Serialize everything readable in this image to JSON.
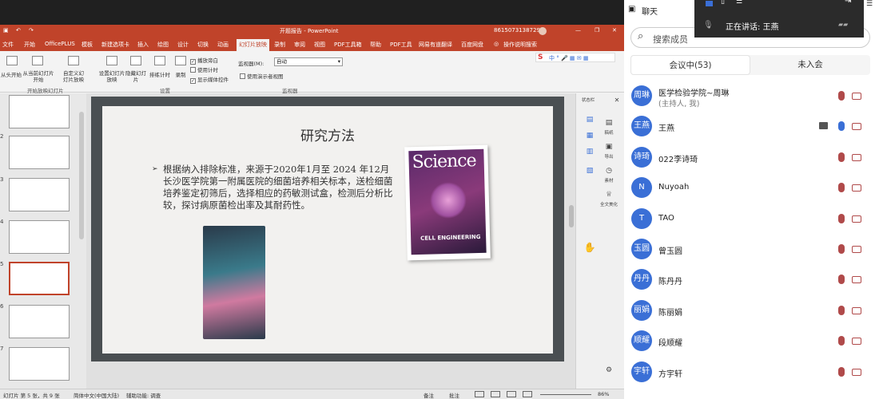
{
  "ppt": {
    "doc_title": "开题报告 - PowerPoint",
    "account": "8615073138729",
    "tabs": [
      "文件",
      "开始",
      "OfficePLUS",
      "模板",
      "新建选项卡",
      "插入",
      "绘图",
      "设计",
      "切换",
      "动画",
      "幻灯片放映",
      "录制",
      "审阅",
      "视图",
      "PDF工具箱",
      "帮助",
      "PDF工具",
      "网易有道翻译",
      "百度网盘",
      "操作说明搜索"
    ],
    "active_tab_index": 10,
    "ribbon": {
      "from_start": "从头开始",
      "from_current": "从当前幻灯片开始",
      "custom": "自定义幻灯片放映",
      "setup": "设置幻灯片放映",
      "hide": "隐藏幻灯片",
      "rehearse": "排练计时",
      "record": "录制",
      "play_narration": "播放旁白",
      "use_timing": "使用计时",
      "show_media": "显示媒体控件",
      "monitor_label": "监视器(M):",
      "monitor_value": "自动",
      "presenter_view": "使用演示者视图",
      "group_start": "开始放映幻灯片",
      "group_setup": "设置",
      "group_monitor": "监视器"
    },
    "thumb_numbers": [
      "2",
      "3",
      "4",
      "5",
      "6",
      "7"
    ],
    "slide": {
      "title": "研究方法",
      "body": "根据纳入排除标准，来源于2020年1月至 2024 年12月长沙医学院第一附属医院的细菌培养相关标本，送检细菌培养鉴定初筛后，选择相应的药敏测试盒，检测后分析比较，探讨病原菌检出率及其耐药性。",
      "cover_title": "Science",
      "cover_subtitle": "CELL ENGINEERING"
    },
    "right_tools": [
      "状态栏",
      "稿纸",
      "导出",
      "素材",
      "全文美化"
    ],
    "status": {
      "slide_info": "幻灯片 第 5 张，共 9 张",
      "language": "简体中文(中国大陆)",
      "accessibility": "辅助功能: 调查",
      "notes": "备注",
      "comments": "批注",
      "zoom": "86%"
    }
  },
  "chat": {
    "title": "聊天",
    "speaking_label": "正在讲话:  王燕",
    "search_placeholder": "搜索成员",
    "tab_in": "会议中(53)",
    "tab_out": "未入会",
    "participants": [
      {
        "avatar": "周琳",
        "name": "医学检验学院~周琳",
        "role": "(主持人, 我)",
        "mic": "muted"
      },
      {
        "avatar": "王燕",
        "name": "王燕",
        "role": "",
        "mic": "on"
      },
      {
        "avatar": "诗琦",
        "name": "022李诗琦",
        "role": "",
        "mic": "muted"
      },
      {
        "avatar": "N",
        "name": "Nuyoah",
        "role": "",
        "mic": "muted"
      },
      {
        "avatar": "T",
        "name": "TAO",
        "role": "",
        "mic": "muted"
      },
      {
        "avatar": "玉圆",
        "name": "曾玉圆",
        "role": "",
        "mic": "muted"
      },
      {
        "avatar": "丹丹",
        "name": "陈丹丹",
        "role": "",
        "mic": "muted"
      },
      {
        "avatar": "丽娟",
        "name": "陈丽娟",
        "role": "",
        "mic": "muted"
      },
      {
        "avatar": "顺耀",
        "name": "段顺耀",
        "role": "",
        "mic": "muted"
      },
      {
        "avatar": "宇轩",
        "name": "方宇轩",
        "role": "",
        "mic": "muted"
      }
    ]
  },
  "colors": {
    "ppt_accent": "#c0432a",
    "avatar_blue": "#3a6fd6",
    "muted_red": "#b04a4a"
  }
}
